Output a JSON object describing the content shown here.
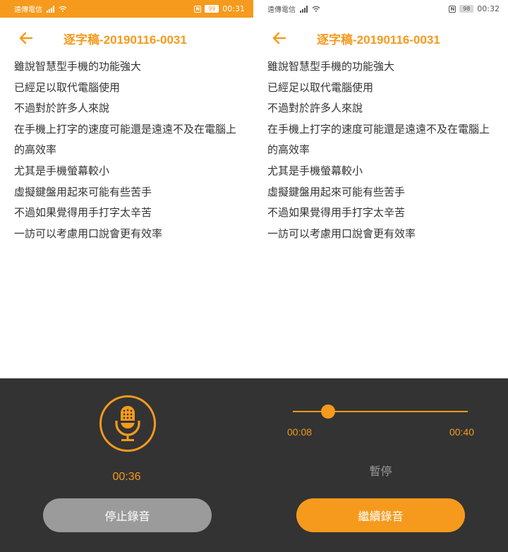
{
  "colors": {
    "accent": "#f59a1d",
    "panel": "#333333",
    "stop_button": "#9b9b9b"
  },
  "transcript_lines": [
    "雖說智慧型手機的功能強大",
    "已經足以取代電腦使用",
    "不過對於許多人來說",
    "在手機上打字的速度可能還是遠遠不及在電腦上",
    "的高效率",
    "尤其是手機螢幕較小",
    "虛擬鍵盤用起來可能有些苦手",
    "不過如果覺得用手打字太辛苦",
    "一訪可以考慮用口說會更有效率"
  ],
  "left": {
    "status": {
      "carrier": "遠傳電信",
      "battery": "99",
      "time": "00:31"
    },
    "title": "逐字稿-20190116-0031",
    "recording": {
      "elapsed": "00:36",
      "stop_label": "停止錄音"
    }
  },
  "right": {
    "status": {
      "carrier": "遠傳電信",
      "battery": "98",
      "time": "00:32"
    },
    "title": "逐字稿-20190116-0031",
    "playback": {
      "current": "00:08",
      "total": "00:40",
      "progress": 0.2,
      "state_label": "暫停",
      "resume_label": "繼續錄音"
    }
  },
  "icons": {
    "back": "arrow-left-icon",
    "mic": "microphone-icon",
    "signal": "signal-icon",
    "wifi": "wifi-icon",
    "nfc": "nfc-icon"
  }
}
